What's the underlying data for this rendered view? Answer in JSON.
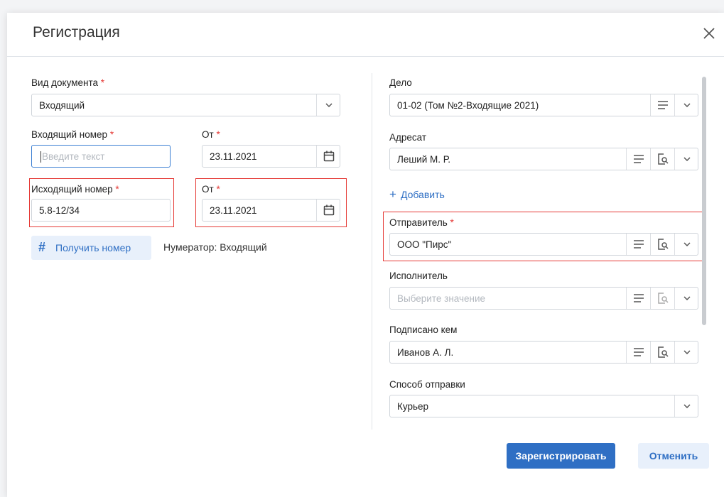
{
  "dialog": {
    "title": "Регистрация"
  },
  "left": {
    "doc_type": {
      "label": "Вид документа",
      "value": "Входящий"
    },
    "incoming_number": {
      "label": "Входящий номер",
      "placeholder": "Введите текст"
    },
    "incoming_date": {
      "label": "От",
      "value": "23.11.2021"
    },
    "outgoing_number": {
      "label": "Исходящий номер",
      "value": "5.8-12/34"
    },
    "outgoing_date": {
      "label": "От",
      "value": "23.11.2021"
    },
    "get_number_label": "Получить номер",
    "numerator": "Нумератор: Входящий",
    "required_mark": "*"
  },
  "right": {
    "case": {
      "label": "Дело",
      "value": "01-02 (Том №2-Входящие 2021)"
    },
    "addressee": {
      "label": "Адресат",
      "value": "Леший М. Р."
    },
    "add_label": "Добавить",
    "sender": {
      "label": "Отправитель",
      "value": "ООО \"Пирс\""
    },
    "executor": {
      "label": "Исполнитель",
      "placeholder": "Выберите значение"
    },
    "signed_by": {
      "label": "Подписано кем",
      "value": "Иванов А. Л."
    },
    "delivery": {
      "label": "Способ отправки",
      "value": "Курьер"
    }
  },
  "footer": {
    "register_label": "Зарегистрировать",
    "cancel_label": "Отменить"
  },
  "colors": {
    "accent": "#2f6fc4",
    "required": "#e53935",
    "highlight": "#e53935"
  }
}
